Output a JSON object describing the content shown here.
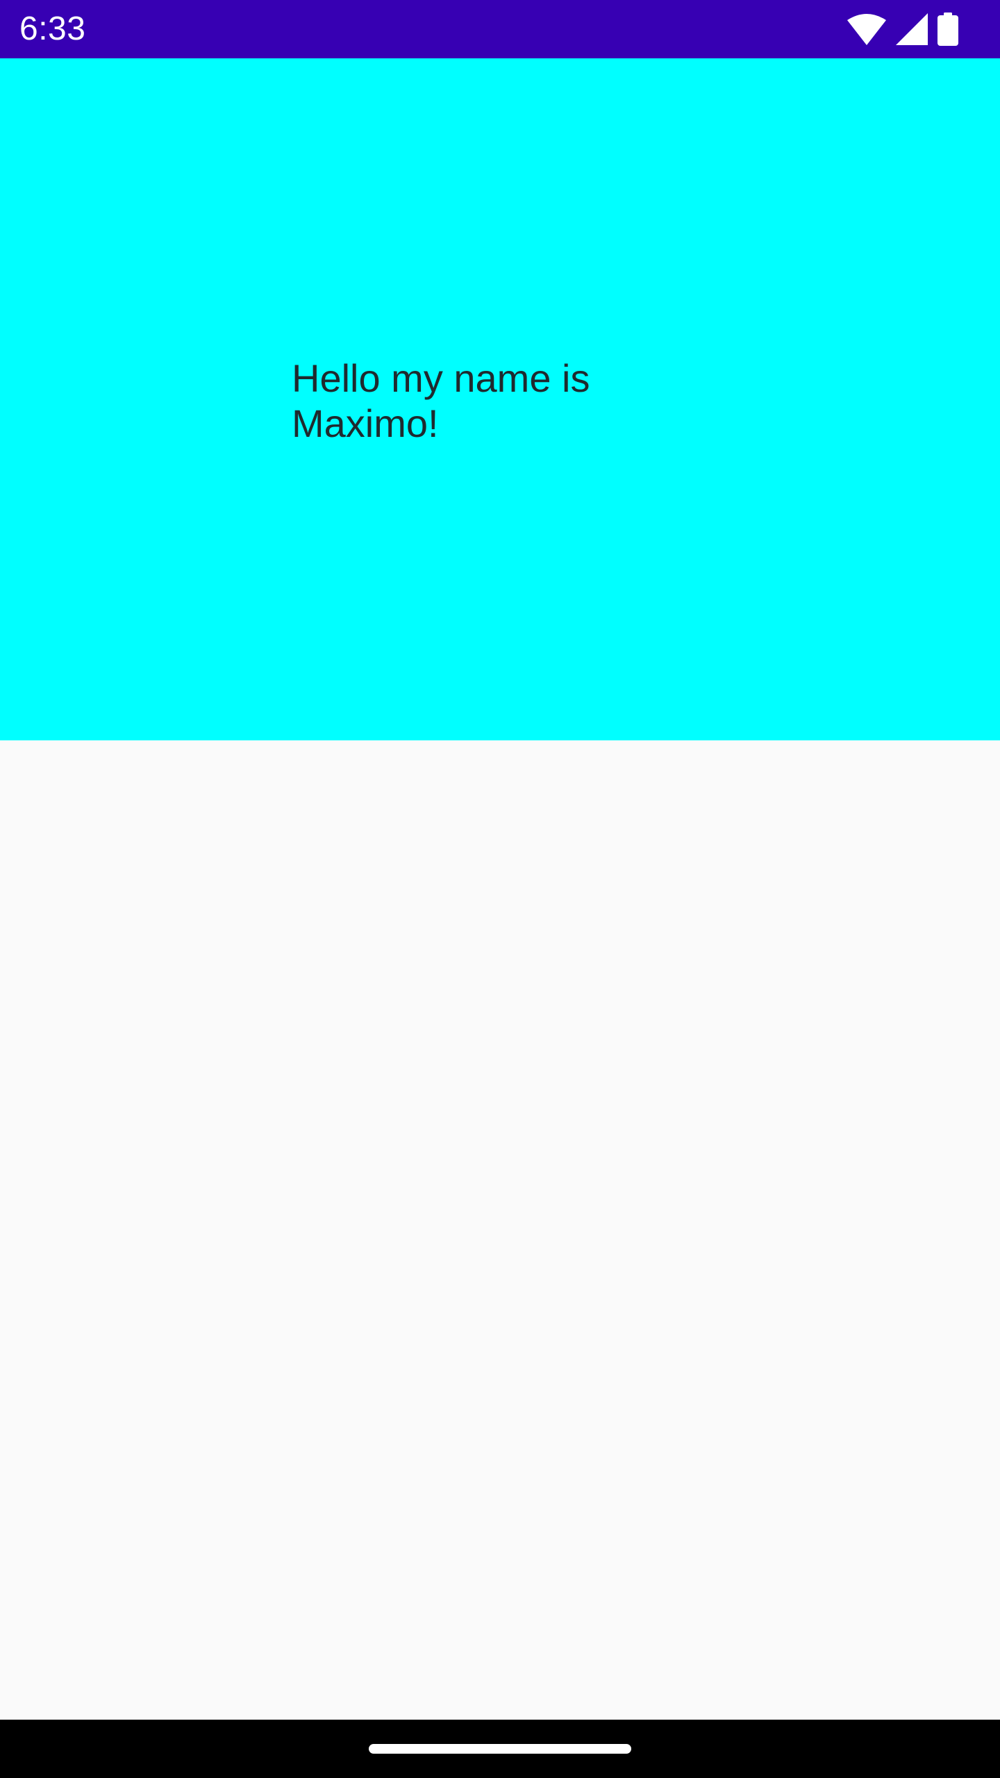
{
  "status_bar": {
    "time": "6:33",
    "background": "#3700b3",
    "icons": [
      "wifi-icon",
      "cellular-signal-icon",
      "battery-icon"
    ]
  },
  "hero": {
    "background": "#00ffff",
    "greeting": "Hello my name is Maximo!"
  },
  "content": {
    "background": "#fafafa"
  },
  "nav_bar": {
    "background": "#000000",
    "handle": "home-handle"
  }
}
